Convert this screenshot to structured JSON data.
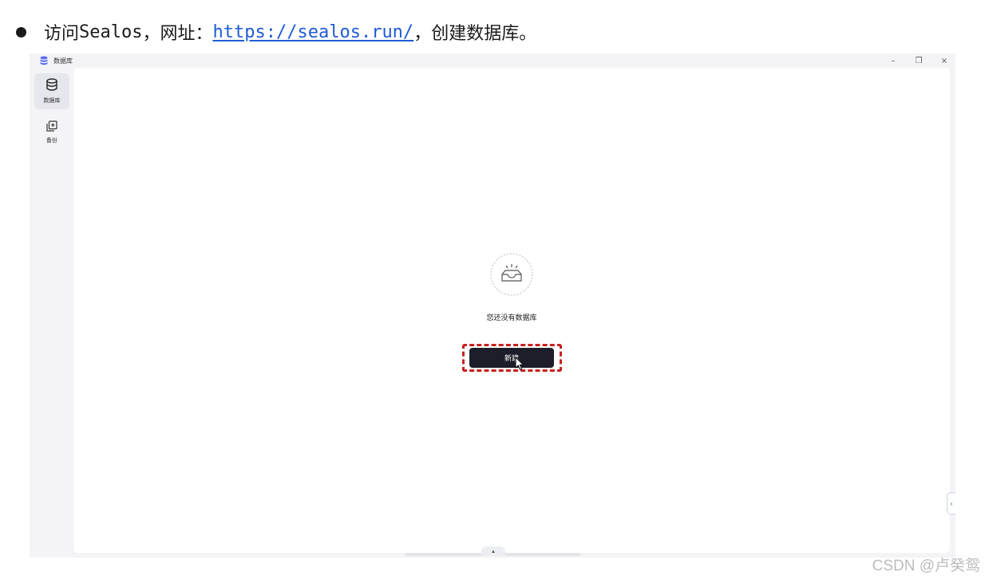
{
  "instruction": {
    "prefix_cn": "访问",
    "prefix_word": "Sealos",
    "mid": "，网址：",
    "url": "https://sealos.run/",
    "suffix": "，创建数据库。"
  },
  "window": {
    "title": "数据库",
    "controls": {
      "minimize": "–",
      "restore": "❐",
      "close": "×"
    }
  },
  "sidebar": {
    "items": [
      {
        "label": "数据库",
        "icon": "database-icon",
        "active": true
      },
      {
        "label": "备份",
        "icon": "backup-icon",
        "active": false
      }
    ]
  },
  "main": {
    "empty_text": "您还没有数据库",
    "create_button": "新建",
    "empty_icon": "empty-inbox-icon"
  },
  "side_toggle": "‹",
  "bottom_toggle": "▴",
  "watermark": "CSDN @卢癸鸳",
  "colors": {
    "accent_dark": "#1c1f2a",
    "highlight": "#c8201d",
    "link": "#1f5bd6"
  }
}
